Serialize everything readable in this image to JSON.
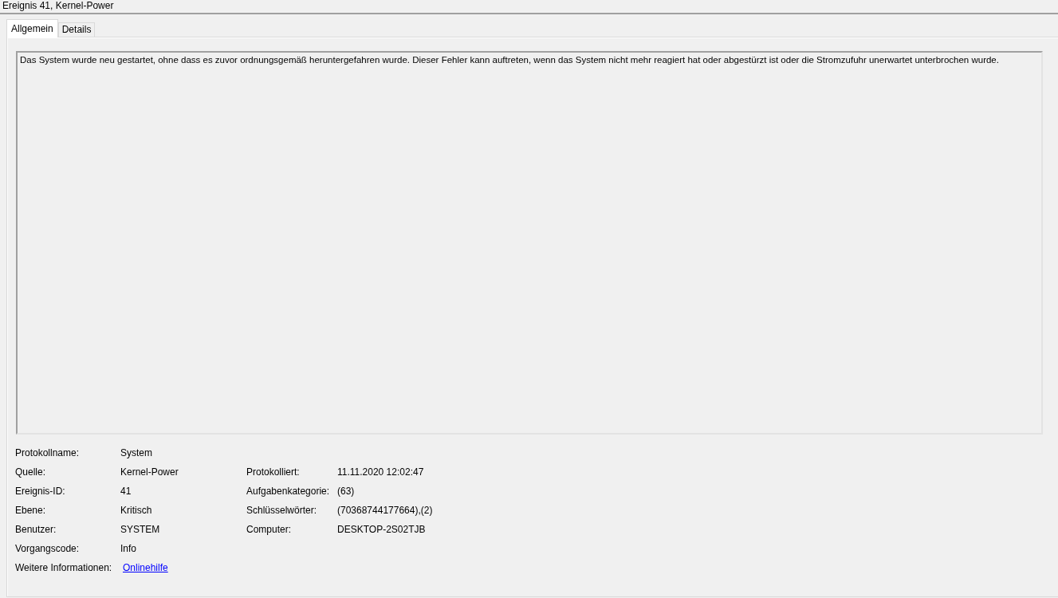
{
  "window": {
    "title": "Ereignis 41, Kernel-Power"
  },
  "tabs": [
    {
      "label": "Allgemein",
      "selected": true
    },
    {
      "label": "Details",
      "selected": false
    }
  ],
  "description": "Das System wurde neu gestartet, ohne dass es zuvor ordnungsgemäß heruntergefahren wurde. Dieser Fehler kann auftreten, wenn das System nicht mehr reagiert hat oder abgestürzt ist oder die Stromzufuhr unerwartet unterbrochen wurde.",
  "properties": [
    {
      "left": {
        "label": "Protokollname:",
        "value": "System",
        "kind": "text"
      }
    },
    {
      "left": {
        "label": "Quelle:",
        "value": "Kernel-Power",
        "kind": "text"
      },
      "right": {
        "label": "Protokolliert:",
        "value": "11.11.2020 12:02:47",
        "kind": "text"
      }
    },
    {
      "left": {
        "label": "Ereignis-ID:",
        "value": "41",
        "kind": "text"
      },
      "right": {
        "label": "Aufgabenkategorie:",
        "value": "(63)",
        "kind": "text"
      }
    },
    {
      "left": {
        "label": "Ebene:",
        "value": "Kritisch",
        "kind": "text"
      },
      "right": {
        "label": "Schlüsselwörter:",
        "value": "(70368744177664),(2)",
        "kind": "text"
      }
    },
    {
      "left": {
        "label": "Benutzer:",
        "value": "SYSTEM",
        "kind": "text"
      },
      "right": {
        "label": "Computer:",
        "value": "DESKTOP-2S02TJB",
        "kind": "text"
      }
    },
    {
      "left": {
        "label": "Vorgangscode:",
        "value": "Info",
        "kind": "text"
      }
    },
    {
      "left": {
        "label": "Weitere Informationen:",
        "value": "Onlinehilfe",
        "kind": "link"
      }
    }
  ]
}
